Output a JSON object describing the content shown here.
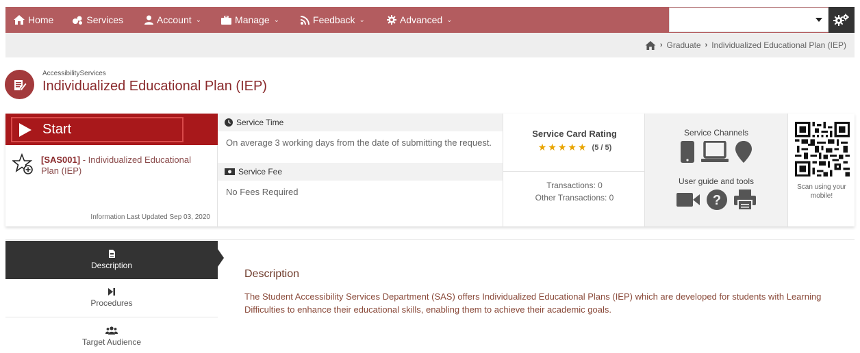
{
  "nav": {
    "items": [
      {
        "label": "Home",
        "icon": "home-icon",
        "chevron": false
      },
      {
        "label": "Services",
        "icon": "services-icon",
        "chevron": false
      },
      {
        "label": "Account",
        "icon": "user-icon",
        "chevron": true
      },
      {
        "label": "Manage",
        "icon": "briefcase-icon",
        "chevron": true
      },
      {
        "label": "Feedback",
        "icon": "rss-icon",
        "chevron": true
      },
      {
        "label": "Advanced",
        "icon": "cog-icon",
        "chevron": true
      }
    ],
    "search_value": "",
    "colors": {
      "bar": "#b35c5f",
      "gear_bg": "#333333"
    }
  },
  "breadcrumb": {
    "items": [
      "Graduate",
      "Individualized Educational Plan (IEP)"
    ]
  },
  "header": {
    "department": "AccessibilityServices",
    "title": "Individualized Educational Plan (IEP)",
    "accent": "#8a2a2c"
  },
  "card": {
    "start_label": "Start",
    "service_code": "[SAS001]",
    "service_name": " - Individualized Educational Plan (IEP)",
    "updated": "Information Last Updated Sep 03, 2020",
    "service_time_label": "Service Time",
    "service_time_value": "On average 3 working days from the date of submitting the request.",
    "service_fee_label": "Service Fee",
    "service_fee_value": "No Fees Required",
    "rating_title": "Service Card Rating",
    "rating_value": 5,
    "rating_text": "(5 / 5)",
    "transactions": "Transactions: 0",
    "other_transactions": "Other Transactions: 0",
    "channels_title": "Service Channels",
    "channels_icons": [
      "mobile-icon",
      "laptop-icon",
      "location-pin-icon"
    ],
    "tools_title": "User guide and tools",
    "tools_icons": [
      "video-icon",
      "help-icon",
      "print-icon"
    ],
    "qr_text": "Scan using your mobile!"
  },
  "tabs": [
    {
      "label": "Description",
      "icon": "file-icon",
      "active": true
    },
    {
      "label": "Procedures",
      "icon": "step-forward-icon",
      "active": false
    },
    {
      "label": "Target Audience",
      "icon": "users-icon",
      "active": false
    }
  ],
  "description": {
    "title": "Description",
    "body": "The Student Accessibility Services Department (SAS) offers Individualized Educational Plans (IEP) which are developed for students with Learning Difficulties to enhance their educational skills, enabling them to achieve their academic goals."
  }
}
